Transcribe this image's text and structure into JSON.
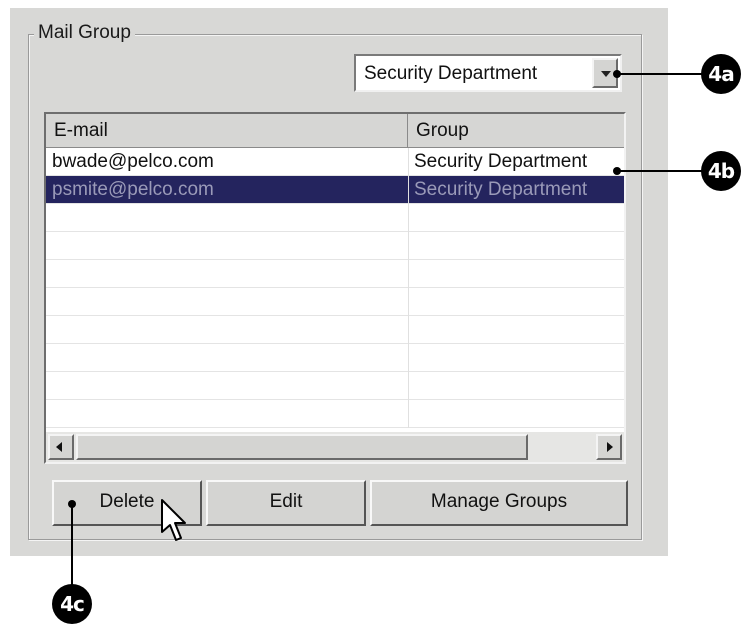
{
  "dialog": {
    "group_title": "Mail Group",
    "group_filter": {
      "selected": "Security Department"
    },
    "list": {
      "columns": [
        "E-mail",
        "Group"
      ],
      "rows": [
        {
          "email": "bwade@pelco.com",
          "group": "Security Department",
          "selected": false
        },
        {
          "email": "psmite@pelco.com",
          "group": "Security Department",
          "selected": true
        }
      ]
    },
    "buttons": {
      "delete": "Delete",
      "edit": "Edit",
      "manage_groups": "Manage Groups"
    }
  },
  "callouts": {
    "a": "4a",
    "b": "4b",
    "c": "4c"
  },
  "icons": {
    "dropdown": "chevron-down-icon",
    "scroll_left": "arrow-left-icon",
    "scroll_right": "arrow-right-icon",
    "cursor": "mouse-pointer-icon"
  }
}
